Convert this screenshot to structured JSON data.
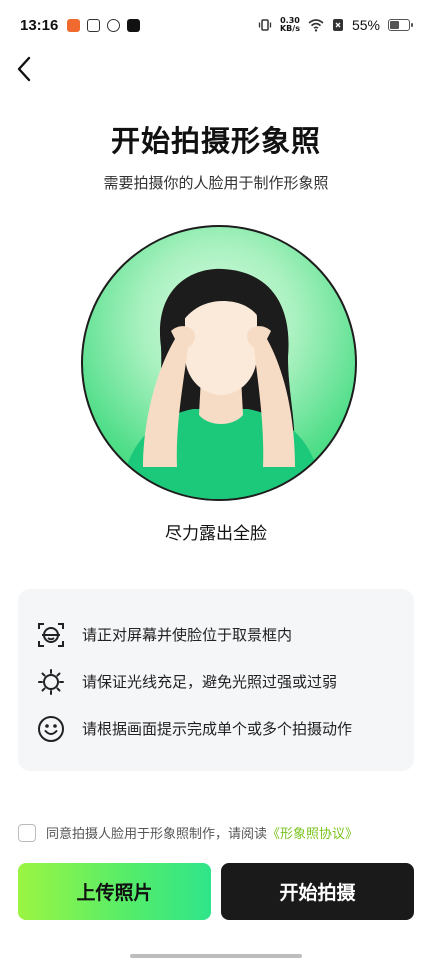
{
  "status_bar": {
    "time": "13:16",
    "net_speed_value": "0.30",
    "net_speed_unit": "KB/s",
    "battery_percent": "55%",
    "battery_level": 0.55
  },
  "page": {
    "title": "开始拍摄形象照",
    "subtitle": "需要拍摄你的人脸用于制作形象照",
    "face_hint": "尽力露出全脸"
  },
  "tips": [
    {
      "icon": "face-scan-icon",
      "text": "请正对屏幕并使脸位于取景框内"
    },
    {
      "icon": "sun-icon",
      "text": "请保证光线充足，避免光照过强或过弱"
    },
    {
      "icon": "smile-icon",
      "text": "请根据画面提示完成单个或多个拍摄动作"
    }
  ],
  "agreement": {
    "text": "同意拍摄人脸用于形象照制作，请阅读",
    "link": "《形象照协议》"
  },
  "buttons": {
    "upload": "上传照片",
    "start": "开始拍摄"
  },
  "colors": {
    "accent_green": "#52ec6c",
    "link_green": "#7bc41e",
    "dark_button": "#1a1a1a"
  }
}
